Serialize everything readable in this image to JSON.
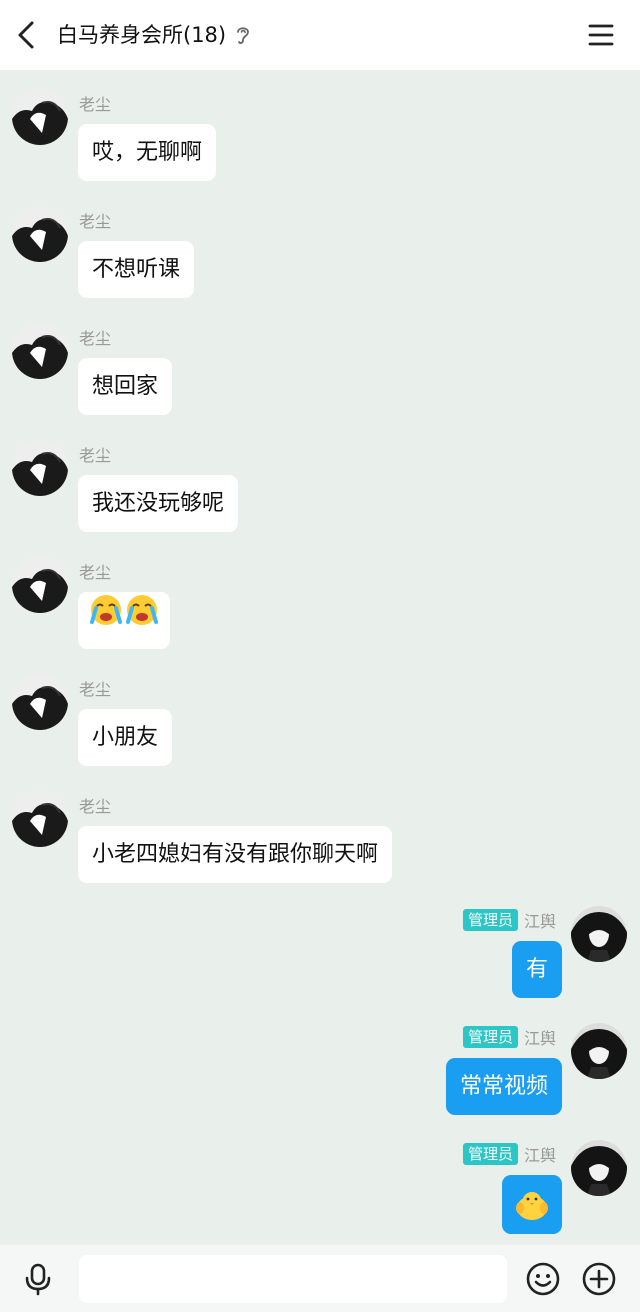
{
  "header": {
    "title": "白马养身会所(18)",
    "icons": [
      "back-arrow-icon",
      "ear-icon",
      "menu-icon"
    ]
  },
  "messages": [
    {
      "side": "left",
      "sender": "老尘",
      "text": "哎，无聊啊"
    },
    {
      "side": "left",
      "sender": "老尘",
      "text": "不想听课"
    },
    {
      "side": "left",
      "sender": "老尘",
      "text": "想回家"
    },
    {
      "side": "left",
      "sender": "老尘",
      "text": "我还没玩够呢"
    },
    {
      "side": "left",
      "sender": "老尘",
      "emoji": [
        "loudly-crying-face-icon",
        "loudly-crying-face-icon"
      ]
    },
    {
      "side": "left",
      "sender": "老尘",
      "text": "小朋友"
    },
    {
      "side": "left",
      "sender": "老尘",
      "text": "小老四媳妇有没有跟你聊天啊"
    },
    {
      "side": "right",
      "badge": "管理员",
      "sender": "江舆",
      "text": "有"
    },
    {
      "side": "right",
      "badge": "管理员",
      "sender": "江舆",
      "text": "常常视频"
    },
    {
      "side": "right",
      "badge": "管理员",
      "sender": "江舆",
      "sticker": "yellow-chick-sticker-icon"
    }
  ],
  "composer": {
    "value": "",
    "icons": [
      "microphone-icon",
      "smiley-icon",
      "plus-icon"
    ]
  },
  "colors": {
    "chat_background": "#e9efea",
    "outgoing_bubble": "#1a9ef2",
    "admin_badge": "#2cc6c6"
  }
}
